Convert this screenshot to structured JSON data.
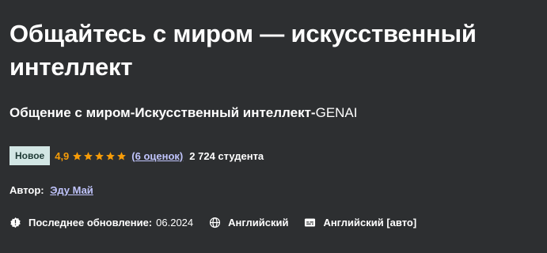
{
  "course": {
    "title": "Общайтесь с миром — искусственный интеллект",
    "subtitle_bold": "Общение с миром-Искусственный интеллект-",
    "subtitle_regular": "GENAI"
  },
  "rating": {
    "badge": "Новое",
    "score": "4,9",
    "stars": 5,
    "ratings_link": "(6 оценок)",
    "students": "2 724 студента",
    "star_color": "#f69c08"
  },
  "author": {
    "label": "Автор:",
    "name": "Эду Май"
  },
  "meta": {
    "updated_label": "Последнее обновление:",
    "updated_value": "06.2024",
    "updated_icon": "alert-badge-icon",
    "language": "Английский",
    "language_icon": "globe-icon",
    "captions": "Английский [авто]",
    "captions_icon": "closed-captions-icon"
  },
  "colors": {
    "background": "#2d2f31",
    "link": "#c0c4fc",
    "badge_bg": "#d2e6e4"
  }
}
